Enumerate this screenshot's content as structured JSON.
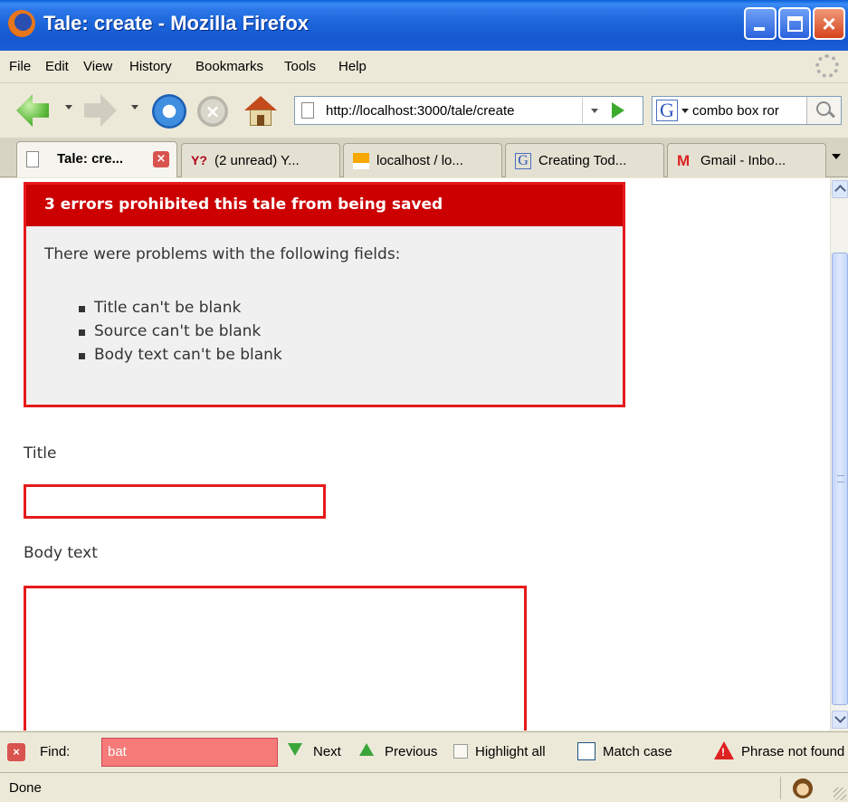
{
  "window": {
    "title": "Tale: create - Mozilla Firefox",
    "minimize_glyph": "",
    "close_glyph": "×"
  },
  "menu": [
    "File",
    "Edit",
    "View",
    "History",
    "Bookmarks",
    "Tools",
    "Help"
  ],
  "nav": {
    "url": "http://localhost:3000/tale/create",
    "search_text": "combo box ror",
    "search_engine_glyph": "G",
    "stop_glyph": "×"
  },
  "tabs": [
    {
      "label": "Tale: cre...",
      "icon": "page-icon",
      "active": true,
      "close": "×"
    },
    {
      "label": "(2 unread) Y...",
      "icon": "yahoo-icon",
      "glyph": "Y?"
    },
    {
      "label": "localhost / lo...",
      "icon": "phpmyadmin-icon"
    },
    {
      "label": "Creating Tod...",
      "icon": "google-icon",
      "glyph": "G"
    },
    {
      "label": "Gmail - Inbo...",
      "icon": "gmail-icon",
      "glyph": "M"
    }
  ],
  "errors": {
    "heading": "3 errors prohibited this tale from being saved",
    "intro": "There were problems with the following fields:",
    "items": [
      "Title can't be blank",
      "Source can't be blank",
      "Body text can't be blank"
    ]
  },
  "form": {
    "title_label": "Title",
    "title_value": "",
    "body_label": "Body text",
    "body_value": ""
  },
  "findbar": {
    "close_glyph": "×",
    "label": "Find:",
    "query": "bat",
    "next": "Next",
    "previous": "Previous",
    "highlight_all": "Highlight all",
    "match_case": "Match case",
    "warning_glyph": "!",
    "status": "Phrase not found"
  },
  "statusbar": {
    "status": "Done"
  },
  "colors": {
    "error_red": "#e51a1a",
    "error_header": "#cc0000",
    "find_not_found": "#f57a78"
  }
}
